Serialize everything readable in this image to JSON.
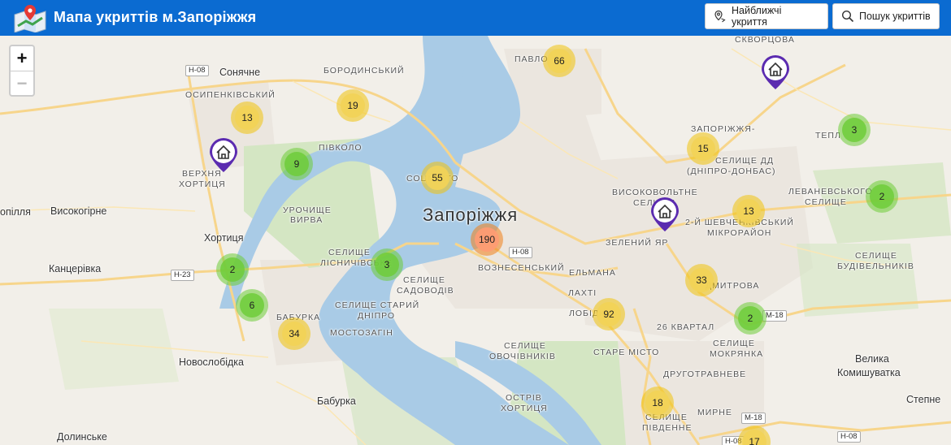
{
  "header": {
    "title": "Мапа укриттів м.Запоріжжя",
    "nearest_label": "Найближчі укриття",
    "search_label": "Пошук укриттів",
    "bg_color": "#0b6bd1"
  },
  "zoom": {
    "in_label": "+",
    "out_label": "−"
  },
  "labels": {
    "zaporizhzhia": "Запоріжжя",
    "soniachne": "Сонячне",
    "osypenkivskyi": "ОСИПЕНКІВСЬКИЙ",
    "borodinskyi": "БОРОДИНСЬКИЙ",
    "pavlo": "ПАВЛО",
    "skvortsova": "СКВОРЦОВА",
    "zaporizhzhia2": "ЗАПОРІЖЖЯ-",
    "selyshche_dd": "СЕЛИЩЕ ДД",
    "dnipro_donbas": "(ДНІПРО-ДОНБАС)",
    "tepli": "ТЕПЛ",
    "pivkolo": "ПІВКОЛО",
    "verkhnia": "ВЕРХНЯ",
    "khortytsia_d": "ХОРТИЦЯ",
    "opillia": "опілля",
    "vysokohirne": "Високогірне",
    "urochyshche": "УРОЧИЩЕ",
    "vyrva": "ВИРВА",
    "sotsmisto": "СОЦМІСТО",
    "vysokovoltne": "ВИСОКОВОЛЬТНЕ",
    "selyshche_v": "СЕЛИЩЕ",
    "levanevskoho": "ЛЕВАНЕВСЬКОГО",
    "selyshche_l": "СЕЛИЩЕ",
    "druhyi_shevchenkivskyi": "2-Й ШЕВЧЕНКІВСЬКИЙ",
    "mikroraion": "МІКРОРАЙОН",
    "khortytsia": "Хортиця",
    "kantserivka": "Канцерівка",
    "selyshche_lis": "СЕЛИЩЕ",
    "lisnychivske": "ЛІСНИЧІВСЬКЕ",
    "zelenyi_yar": "ЗЕЛЕНИЙ ЯР",
    "selyshche_bud": "СЕЛИЩЕ",
    "budivelnykiv": "БУДІВЕЛЬНИКІВ",
    "voznesenskyi": "ВОЗНЕСЕНСЬКИЙ",
    "selyshche_sad": "СЕЛИЩЕ",
    "sadovodiv": "САДОВОДІВ",
    "selyshche_st": "СЕЛИЩЕ СТАРИЙ",
    "dnipro": "ДНІПРО",
    "babyrka": "БАБУРКА",
    "mostozahin": "МОСТОЗАГІН",
    "selmana": "ЕЛЬМАНА",
    "lakhti": "ЛАХТІ",
    "slobidka": "ЛОБІДКА",
    "dmitrova": "ДМИТРОВА",
    "kvartal26": "26 КВАРТАЛ",
    "selyshche_ov": "СЕЛИЩЕ",
    "ovochivnykiv": "ОВОЧІВНИКІВ",
    "stare_misto": "СТАРЕ МІСТО",
    "selyshche_m": "СЕЛИЩЕ",
    "mokrianka": "МОКРЯНКА",
    "velyka": "Велика",
    "komyshuvatka": "Комишуватка",
    "novoslobidka": "Новослобідка",
    "druhotravneve": "ДРУГОТРАВНЕВЕ",
    "ostriv": "ОСТРІВ",
    "khortytsia_o": "ХОРТИЦЯ",
    "babyrka_town": "Бабурка",
    "stepne": "Степне",
    "myrne": "МИРНЕ",
    "selyshche_p": "СЕЛИЩЕ",
    "pivdenne": "ПІВДЕННЕ",
    "dolynske": "Долинське"
  },
  "roads": [
    "Н-08",
    "Н-23",
    "Н-08",
    "М-18",
    "М-18",
    "Н-08",
    "Н-08"
  ],
  "clusters": [
    {
      "count": "66",
      "level": "yellow"
    },
    {
      "count": "13",
      "level": "yellow"
    },
    {
      "count": "19",
      "level": "yellow"
    },
    {
      "count": "3",
      "level": "green"
    },
    {
      "count": "9",
      "level": "green"
    },
    {
      "count": "55",
      "level": "yellow"
    },
    {
      "count": "15",
      "level": "yellow"
    },
    {
      "count": "2",
      "level": "green"
    },
    {
      "count": "13",
      "level": "yellow"
    },
    {
      "count": "190",
      "level": "orange"
    },
    {
      "count": "2",
      "level": "green"
    },
    {
      "count": "3",
      "level": "green"
    },
    {
      "count": "33",
      "level": "yellow"
    },
    {
      "count": "6",
      "level": "green"
    },
    {
      "count": "92",
      "level": "yellow"
    },
    {
      "count": "2",
      "level": "green"
    },
    {
      "count": "34",
      "level": "yellow"
    },
    {
      "count": "18",
      "level": "yellow"
    },
    {
      "count": "17",
      "level": "yellow"
    }
  ],
  "pins": [
    "shelter-pin",
    "shelter-pin",
    "shelter-pin"
  ],
  "colors": {
    "water": "#a9cbe6",
    "land": "#f2efe9",
    "park": "#d4e6c3",
    "urban": "#ebe6df",
    "road_major": "#f7d58b",
    "pin": "#5b2bb0"
  }
}
